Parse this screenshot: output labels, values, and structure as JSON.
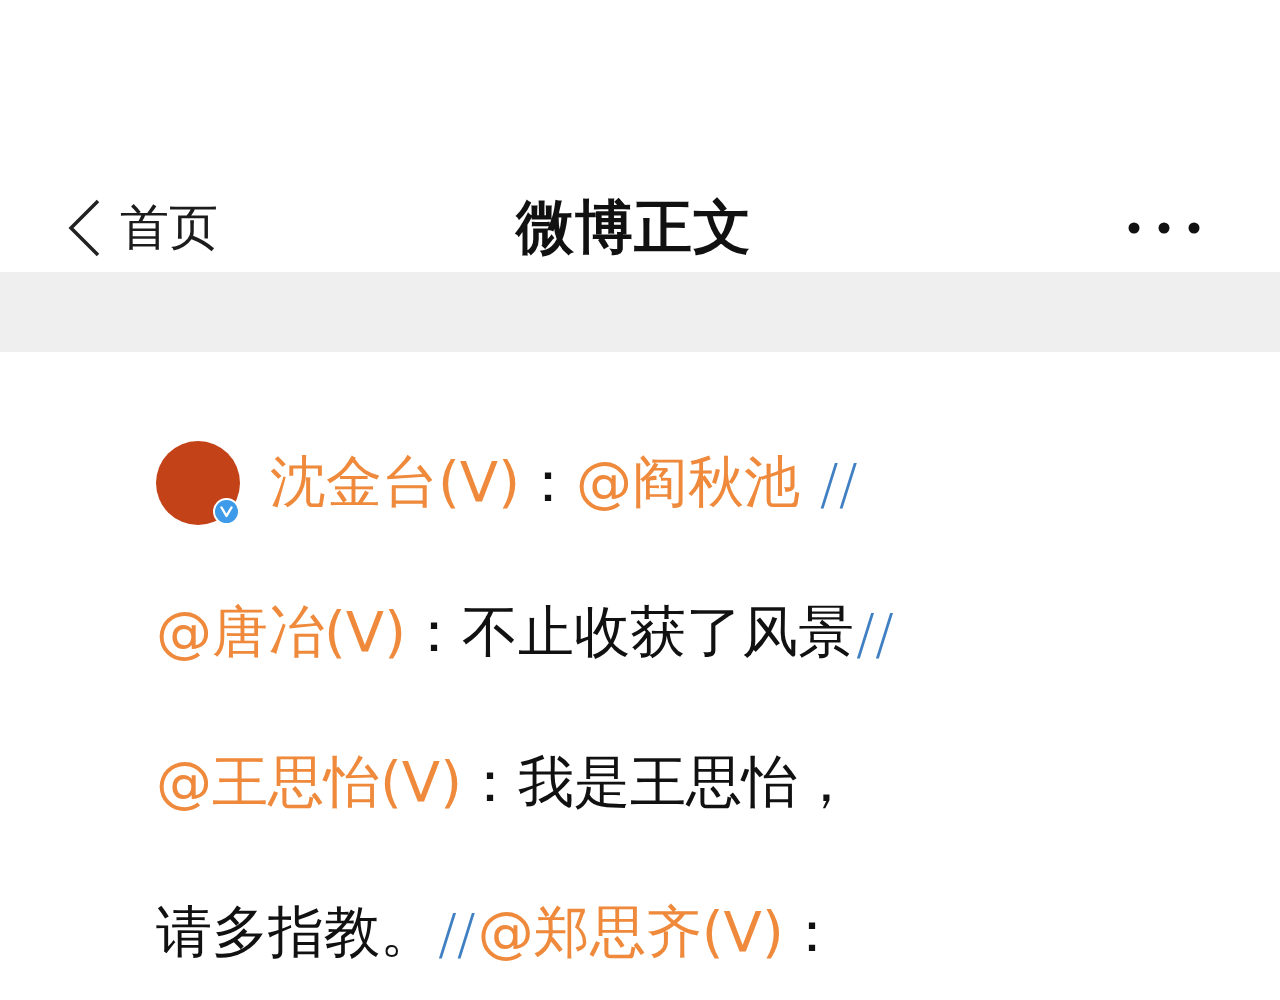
{
  "header": {
    "back": {
      "label": "首页"
    },
    "title": "微博正文"
  },
  "post": {
    "lines": [
      {
        "avatar": {
          "verified": true
        },
        "segments": [
          {
            "kind": "author",
            "text": "沈金台(V)"
          },
          {
            "kind": "text",
            "text": "："
          },
          {
            "kind": "mention",
            "text": "@阎秋池"
          },
          {
            "kind": "separator",
            "text": " //"
          }
        ]
      },
      {
        "segments": [
          {
            "kind": "mention",
            "text": "@唐冶(V)"
          },
          {
            "kind": "text",
            "text": "：不止收获了风景"
          },
          {
            "kind": "separator",
            "text": "//"
          }
        ]
      },
      {
        "segments": [
          {
            "kind": "mention",
            "text": "@王思怡(V)"
          },
          {
            "kind": "text",
            "text": "：我是王思怡，"
          }
        ]
      },
      {
        "segments": [
          {
            "kind": "text",
            "text": "请多指教。"
          },
          {
            "kind": "separator",
            "text": "//"
          },
          {
            "kind": "mention",
            "text": "@郑思齐(V)"
          },
          {
            "kind": "text",
            "text": "："
          }
        ]
      }
    ]
  }
}
